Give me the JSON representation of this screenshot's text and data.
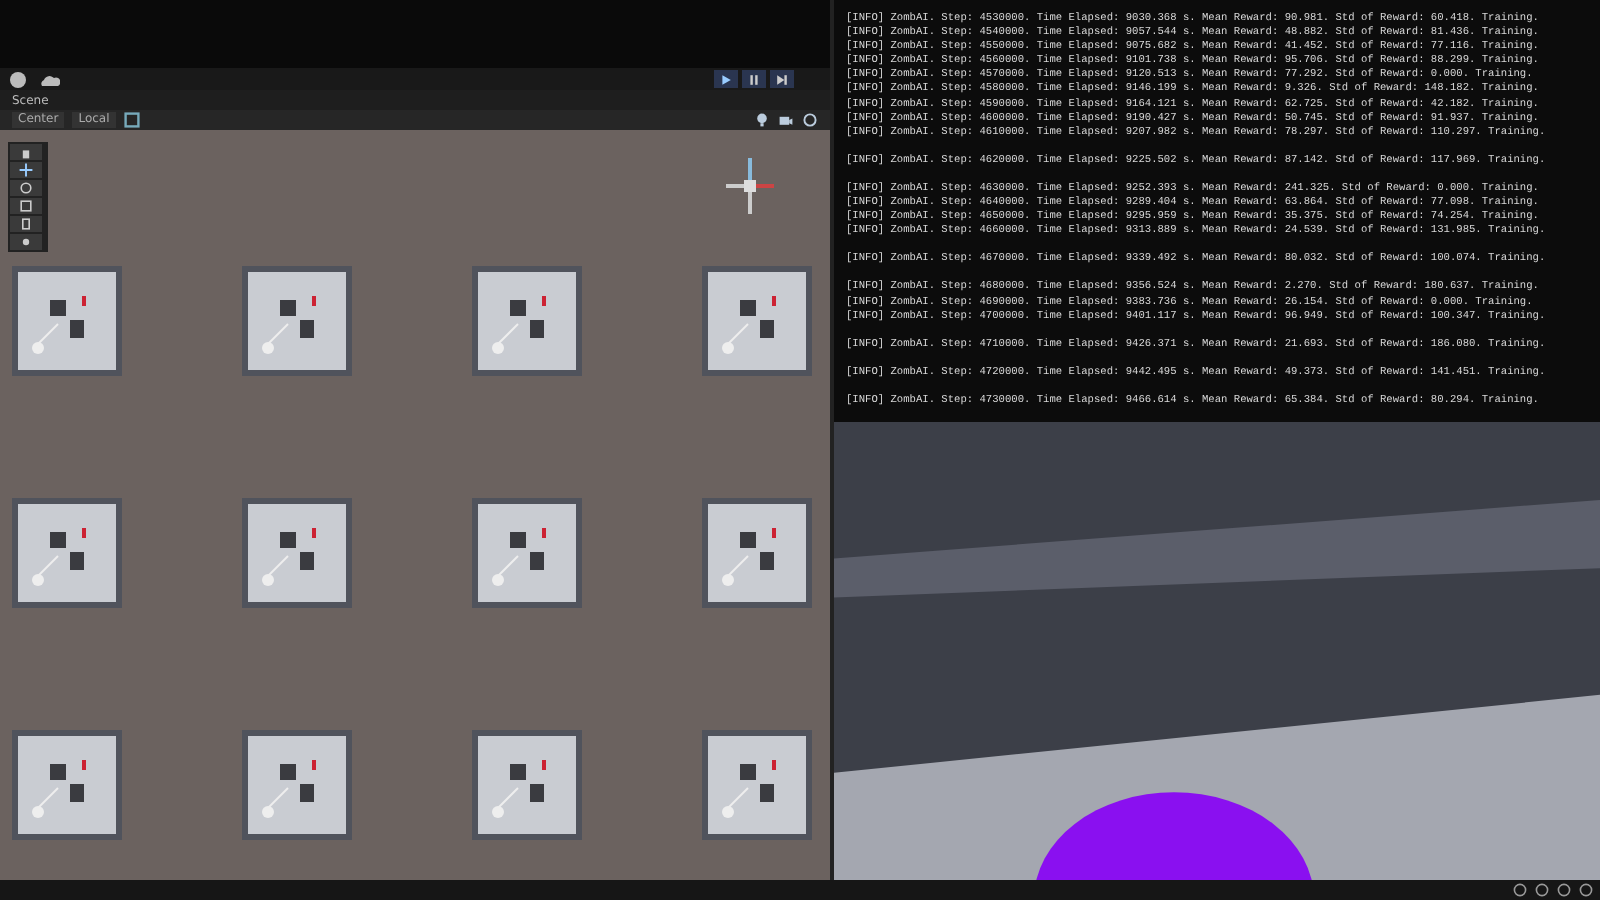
{
  "scene_panel": {
    "tab": "Scene",
    "pivot_mode": "Center",
    "pivot_rotation": "Local"
  },
  "console": {
    "groups": [
      [
        "[INFO] ZombAI. Step: 4530000. Time Elapsed: 9030.368 s. Mean Reward: 90.981. Std of Reward: 60.418. Training.",
        "[INFO] ZombAI. Step: 4540000. Time Elapsed: 9057.544 s. Mean Reward: 48.882. Std of Reward: 81.436. Training.",
        "[INFO] ZombAI. Step: 4550000. Time Elapsed: 9075.682 s. Mean Reward: 41.452. Std of Reward: 77.116. Training.",
        "[INFO] ZombAI. Step: 4560000. Time Elapsed: 9101.738 s. Mean Reward: 95.706. Std of Reward: 88.299. Training.",
        "[INFO] ZombAI. Step: 4570000. Time Elapsed: 9120.513 s. Mean Reward: 77.292. Std of Reward: 0.000. Training.",
        "[INFO] ZombAI. Step: 4580000. Time Elapsed: 9146.199 s. Mean Reward: 9.326. Std of Reward: 148.182. Training.",
        "[INFO] ZombAI. Step: 4590000. Time Elapsed: 9164.121 s. Mean Reward: 62.725. Std of Reward: 42.182. Training.",
        "[INFO] ZombAI. Step: 4600000. Time Elapsed: 9190.427 s. Mean Reward: 50.745. Std of Reward: 91.937. Training.",
        "[INFO] ZombAI. Step: 4610000. Time Elapsed: 9207.982 s. Mean Reward: 78.297. Std of Reward: 110.297. Training."
      ],
      [
        "[INFO] ZombAI. Step: 4620000. Time Elapsed: 9225.502 s. Mean Reward: 87.142. Std of Reward: 117.969. Training."
      ],
      [
        "[INFO] ZombAI. Step: 4630000. Time Elapsed: 9252.393 s. Mean Reward: 241.325. Std of Reward: 0.000. Training.",
        "[INFO] ZombAI. Step: 4640000. Time Elapsed: 9289.404 s. Mean Reward: 63.864. Std of Reward: 77.098. Training.",
        "[INFO] ZombAI. Step: 4650000. Time Elapsed: 9295.959 s. Mean Reward: 35.375. Std of Reward: 74.254. Training.",
        "[INFO] ZombAI. Step: 4660000. Time Elapsed: 9313.889 s. Mean Reward: 24.539. Std of Reward: 131.985. Training."
      ],
      [
        "[INFO] ZombAI. Step: 4670000. Time Elapsed: 9339.492 s. Mean Reward: 80.032. Std of Reward: 100.074. Training."
      ],
      [
        "[INFO] ZombAI. Step: 4680000. Time Elapsed: 9356.524 s. Mean Reward: 2.270. Std of Reward: 180.637. Training.",
        "[INFO] ZombAI. Step: 4690000. Time Elapsed: 9383.736 s. Mean Reward: 26.154. Std of Reward: 0.000. Training.",
        "[INFO] ZombAI. Step: 4700000. Time Elapsed: 9401.117 s. Mean Reward: 96.949. Std of Reward: 100.347. Training."
      ],
      [
        "[INFO] ZombAI. Step: 4710000. Time Elapsed: 9426.371 s. Mean Reward: 21.693. Std of Reward: 186.080. Training."
      ],
      [
        "[INFO] ZombAI. Step: 4720000. Time Elapsed: 9442.495 s. Mean Reward: 49.373. Std of Reward: 141.451. Training."
      ],
      [
        "[INFO] ZombAI. Step: 4730000. Time Elapsed: 9466.614 s. Mean Reward: 65.384. Std of Reward: 80.294. Training."
      ]
    ]
  }
}
